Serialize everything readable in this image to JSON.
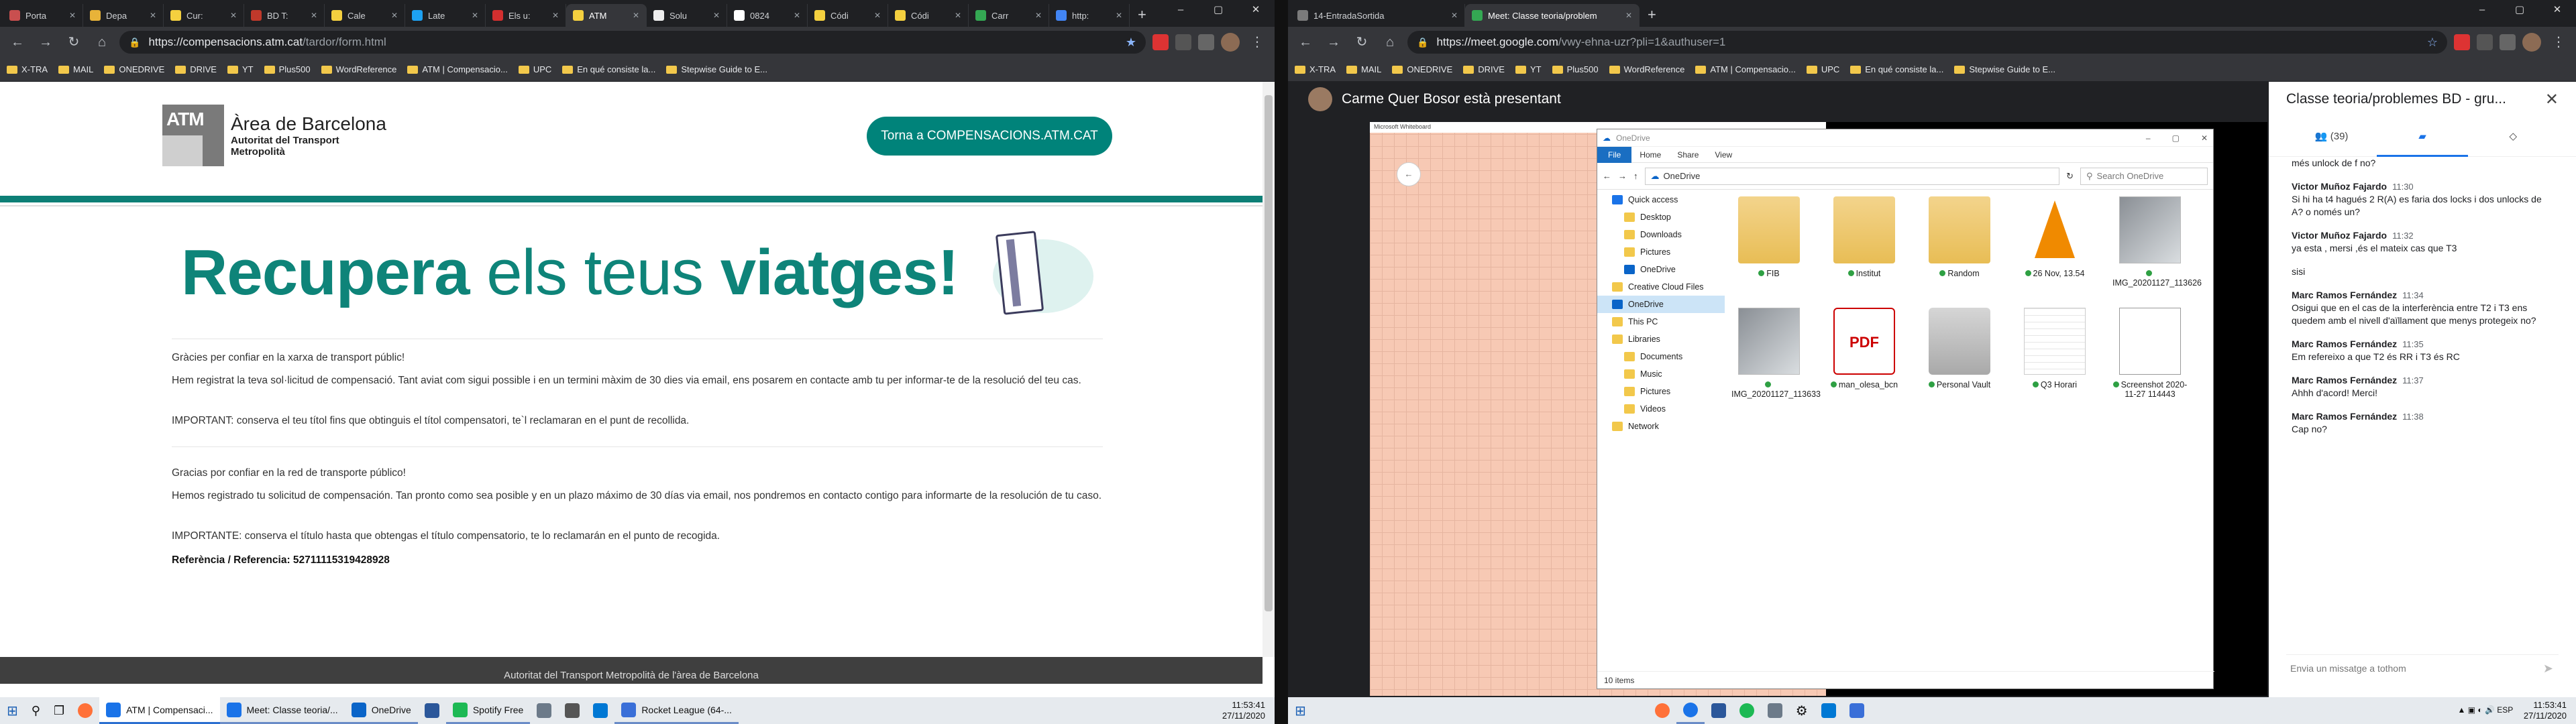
{
  "left": {
    "tabs": [
      {
        "label": "Porta",
        "color": "#c94f4f"
      },
      {
        "label": "Depa",
        "color": "#e8b339"
      },
      {
        "label": "Cur:",
        "color": "#f4d03f"
      },
      {
        "label": "BD T:",
        "color": "#c0392b"
      },
      {
        "label": "Cale",
        "color": "#f4d03f"
      },
      {
        "label": "Late",
        "color": "#1da1f2"
      },
      {
        "label": "Els u:",
        "color": "#d32f2f"
      },
      {
        "label": "ATM",
        "color": "#f4d03f"
      },
      {
        "label": "Solu",
        "color": "#eeeeee"
      },
      {
        "label": "0824",
        "color": "#ffffff"
      },
      {
        "label": "Códi",
        "color": "#f4d03f"
      },
      {
        "label": "Códi",
        "color": "#f4d03f"
      },
      {
        "label": "Carr",
        "color": "#34a853"
      },
      {
        "label": "http:",
        "color": "#4285f4"
      }
    ],
    "active_tab_index": 7,
    "url_host": "https://compensacions.atm.cat",
    "url_path": "/tardor/form.html",
    "bookmarks": [
      "X-TRA",
      "MAIL",
      "ONEDRIVE",
      "DRIVE",
      "YT",
      "Plus500",
      "WordReference",
      "ATM | Compensacio...",
      "UPC",
      "En qué consiste la...",
      "Stepwise Guide to E..."
    ],
    "page": {
      "logo_text": "ATM",
      "logo_title": "Àrea de Barcelona",
      "logo_sub1": "Autoritat del Transport",
      "logo_sub2": "Metropolità",
      "return_button": "Torna a COMPENSACIONS.ATM.CAT",
      "hero_part1": "Recupera",
      "hero_part2": " els teus ",
      "hero_part3": "viatges!",
      "ca_p1": "Gràcies per confiar en la xarxa de transport públic!",
      "ca_p2": "Hem registrat la teva sol·licitud de compensació. Tant aviat com sigui possible i en un termini màxim de 30 dies via email, ens posarem en contacte amb tu per informar-te de la resolució del teu cas.",
      "ca_p3": "IMPORTANT: conserva el teu títol fins que obtinguis el títol compensatori, te`l reclamaran en el punt de recollida.",
      "es_p1": "Gracias por confiar en la red de transporte público!",
      "es_p2": "Hemos registrado tu solicitud de compensación. Tan pronto como sea posible y en un plazo máximo de 30 días via email, nos pondremos en contacto contigo para informarte de la resolución de tu caso.",
      "es_p3": "IMPORTANTE: conserva el título hasta que obtengas el título compensatorio, te lo reclamarán en el punto de recogida.",
      "reference": "Referència / Referencia: 52711115319428928",
      "footer": "Autoritat del Transport Metropolità de l'àrea de Barcelona"
    },
    "taskbar": {
      "items": [
        {
          "label": "ATM | Compensaci...",
          "color": "#1a73e8"
        },
        {
          "label": "Meet: Classe teoria/...",
          "color": "#1a73e8"
        },
        {
          "label": "OneDrive",
          "color": "#0a64c8"
        },
        {
          "label": "",
          "color": "#2b579a"
        },
        {
          "label": "Spotify Free",
          "color": "#1db954"
        },
        {
          "label": "",
          "color": "#6c7a89"
        },
        {
          "label": "",
          "color": "#555555"
        },
        {
          "label": "",
          "color": "#0078d4"
        },
        {
          "label": "Rocket League (64-...",
          "color": "#3a6fd8"
        }
      ],
      "time": "11:53:41",
      "date": "27/11/2020"
    }
  },
  "right": {
    "tabs": [
      {
        "label": "14-EntradaSortida",
        "color": "#7b7b7b"
      },
      {
        "label": "Meet: Classe teoria/problem",
        "color": "#34a853"
      }
    ],
    "url_host": "https://meet.google.com",
    "url_path": "/vwy-ehna-uzr?pli=1&authuser=1",
    "bookmarks": [
      "X-TRA",
      "MAIL",
      "ONEDRIVE",
      "DRIVE",
      "YT",
      "Plus500",
      "WordReference",
      "ATM | Compensacio...",
      "UPC",
      "En qué consiste la...",
      "Stepwise Guide to E..."
    ],
    "meet": {
      "presenter": "Carme Quer Bosor està presentant",
      "whiteboard_title": "Microsoft Whiteboard",
      "explorer": {
        "title": "OneDrive",
        "ribbon": [
          "File",
          "Home",
          "Share",
          "View"
        ],
        "path": "OneDrive",
        "search_placeholder": "Search OneDrive",
        "nav": [
          {
            "label": "Quick access",
            "sub": false,
            "sel": false
          },
          {
            "label": "Desktop",
            "sub": true,
            "sel": false
          },
          {
            "label": "Downloads",
            "sub": true,
            "sel": false
          },
          {
            "label": "Pictures",
            "sub": true,
            "sel": false
          },
          {
            "label": "OneDrive",
            "sub": true,
            "sel": false
          },
          {
            "label": "Creative Cloud Files",
            "sub": false,
            "sel": false
          },
          {
            "label": "OneDrive",
            "sub": false,
            "sel": true
          },
          {
            "label": "This PC",
            "sub": false,
            "sel": false
          },
          {
            "label": "Libraries",
            "sub": false,
            "sel": false
          },
          {
            "label": "Documents",
            "sub": true,
            "sel": false
          },
          {
            "label": "Music",
            "sub": true,
            "sel": false
          },
          {
            "label": "Pictures",
            "sub": true,
            "sel": false
          },
          {
            "label": "Videos",
            "sub": true,
            "sel": false
          },
          {
            "label": "Network",
            "sub": false,
            "sel": false
          }
        ],
        "items": [
          {
            "name": "FIB",
            "kind": "folder"
          },
          {
            "name": "Institut",
            "kind": "folder"
          },
          {
            "name": "Random",
            "kind": "folder"
          },
          {
            "name": "26 Nov, 13.54",
            "kind": "vlc"
          },
          {
            "name": "IMG_20201127_113626",
            "kind": "img"
          },
          {
            "name": "IMG_20201127_113633",
            "kind": "img"
          },
          {
            "name": "man_olesa_bcn",
            "kind": "pdf"
          },
          {
            "name": "Personal Vault",
            "kind": "vault"
          },
          {
            "name": "Q3 Horari",
            "kind": "xls"
          },
          {
            "name": "Screenshot 2020-11-27 114443",
            "kind": "doc"
          }
        ],
        "status": "10 items"
      },
      "chat": {
        "title": "Classe teoria/problemes BD - gru...",
        "participants": "(39)",
        "messages": [
          {
            "who": "",
            "time": "",
            "text": "més unlock de f no?"
          },
          {
            "who": "Victor Muñoz Fajardo",
            "time": "11:30",
            "text": "Si hi ha t4 hagués 2 R(A) es faria dos locks i dos unlocks de A? o només un?"
          },
          {
            "who": "Victor Muñoz Fajardo",
            "time": "11:32",
            "text": "ya esta , mersi ,és el mateix cas que T3"
          },
          {
            "who": "",
            "time": "",
            "text": "sisi"
          },
          {
            "who": "Marc Ramos Fernández",
            "time": "11:34",
            "text": "Osigui que en el cas de la interferència entre T2 i T3 ens quedem amb el nivell d'aïllament que menys protegeix no?"
          },
          {
            "who": "Marc Ramos Fernández",
            "time": "11:35",
            "text": "Em refereixo a que T2 és RR i T3 és RC"
          },
          {
            "who": "Marc Ramos Fernández",
            "time": "11:37",
            "text": "Ahhh d'acord! Merci!"
          },
          {
            "who": "Marc Ramos Fernández",
            "time": "11:38",
            "text": "Cap no?"
          }
        ],
        "input_placeholder": "Envia un missatge a tothom"
      }
    },
    "taskbar": {
      "time": "11:53:41",
      "date": "27/11/2020",
      "lang": "ESP"
    }
  }
}
